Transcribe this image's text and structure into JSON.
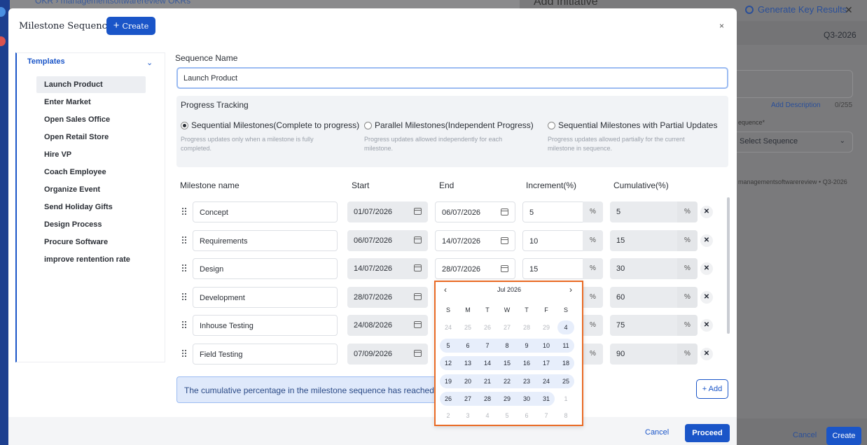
{
  "background": {
    "breadcrumb_partial": "OKR  ›  managementsoftwarereview OKRs",
    "panel_title_partial": "Add Initiative",
    "generate_label": "Generate Key Results",
    "close_glyph": "✕",
    "quarter": "Q3-2026",
    "add_description": "Add Description",
    "char_count": "0/255",
    "sequence_label_partial": "equence*",
    "select_sequence_placeholder": "Select Sequence",
    "meta_line": "managementsoftwarereview • Q3-2026",
    "cancel": "Cancel",
    "create": "Create"
  },
  "modal": {
    "title": "Milestone Sequence",
    "create_button": "Create",
    "close_glyph": "×"
  },
  "templates": {
    "heading": "Templates",
    "items": [
      "Launch Product",
      "Enter Market",
      "Open Sales Office",
      "Open Retail Store",
      "Hire VP",
      "Coach Employee",
      "Organize Event",
      "Send Holiday Gifts",
      "Design Process",
      "Procure Software",
      "improve rentention rate"
    ],
    "active_index": 0
  },
  "form": {
    "sequence_name_label": "Sequence Name",
    "sequence_name_value": "Launch Product",
    "progress_tracking_label": "Progress Tracking",
    "options": [
      {
        "label": "Sequential Milestones(Complete to progress)",
        "desc": "Progress updates only when a milestone is fully completed.",
        "selected": true
      },
      {
        "label": "Parallel Milestones(Independent Progress)",
        "desc": "Progress updates allowed independently for each milestone.",
        "selected": false
      },
      {
        "label": "Sequential Milestones with Partial Updates",
        "desc": "Progress updates allowed partially for the current milestone in sequence.",
        "selected": false
      }
    ]
  },
  "table": {
    "headers": [
      "Milestone name",
      "Start",
      "End",
      "Increment(%)",
      "Cumulative(%)"
    ],
    "percent_symbol": "%",
    "delete_glyph": "✕",
    "rows": [
      {
        "name": "Concept",
        "start": "01/07/2026",
        "end": "06/07/2026",
        "increment": "5",
        "cumulative": "5"
      },
      {
        "name": "Requirements",
        "start": "06/07/2026",
        "end": "14/07/2026",
        "increment": "10",
        "cumulative": "15"
      },
      {
        "name": "Design",
        "start": "14/07/2026",
        "end": "28/07/2026",
        "increment": "15",
        "cumulative": "30"
      },
      {
        "name": "Development",
        "start": "28/07/2026",
        "end": "",
        "increment": "",
        "cumulative": "60"
      },
      {
        "name": "Inhouse Testing",
        "start": "24/08/2026",
        "end": "",
        "increment": "",
        "cumulative": "75"
      },
      {
        "name": "Field Testing",
        "start": "07/09/2026",
        "end": "",
        "increment": "",
        "cumulative": "90"
      }
    ]
  },
  "info_message": "The cumulative percentage in the milestone sequence has reached 100",
  "add_button": "+ Add",
  "footer": {
    "cancel": "Cancel",
    "proceed": "Proceed"
  },
  "datepicker": {
    "month_label": "Jul  2026",
    "prev_glyph": "‹",
    "next_glyph": "›",
    "weekdays": [
      "S",
      "M",
      "T",
      "W",
      "T",
      "F",
      "S"
    ],
    "weeks": [
      [
        "24",
        "25",
        "26",
        "27",
        "28",
        "29",
        "4"
      ],
      [
        "5",
        "6",
        "7",
        "8",
        "9",
        "10",
        "11"
      ],
      [
        "12",
        "13",
        "14",
        "15",
        "16",
        "17",
        "18"
      ],
      [
        "19",
        "20",
        "21",
        "22",
        "23",
        "24",
        "25"
      ],
      [
        "26",
        "27",
        "28",
        "29",
        "30",
        "31",
        "1"
      ],
      [
        "2",
        "3",
        "4",
        "5",
        "6",
        "7",
        "8"
      ]
    ],
    "muted": [
      [
        true,
        true,
        true,
        true,
        true,
        true,
        false
      ],
      [
        false,
        false,
        false,
        false,
        false,
        false,
        false
      ],
      [
        false,
        false,
        false,
        false,
        false,
        false,
        false
      ],
      [
        false,
        false,
        false,
        false,
        false,
        false,
        false
      ],
      [
        false,
        false,
        false,
        false,
        false,
        false,
        true
      ],
      [
        true,
        true,
        true,
        true,
        true,
        true,
        true
      ]
    ]
  }
}
